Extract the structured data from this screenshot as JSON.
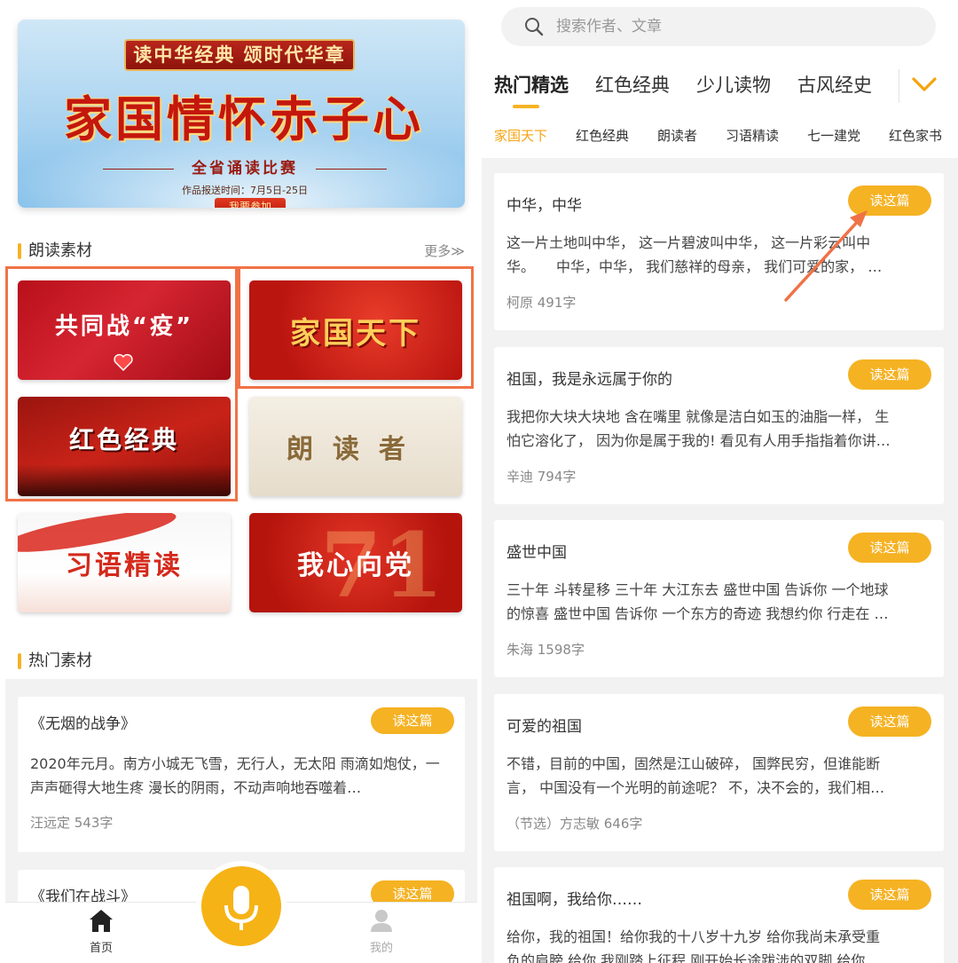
{
  "left": {
    "banner": {
      "plaque": "读中华经典 颂时代华章",
      "title": "家国情怀赤子心",
      "subtitle": "全省诵读比赛",
      "dates": "作品报送时间：7月5日-25日",
      "join": "我要参加"
    },
    "materials": {
      "title": "朗读素材",
      "more": "更多≫",
      "tiles": [
        "共同战“疫”",
        "家国天下",
        "红色经典",
        "朗读者",
        "习语精读",
        "我心向党"
      ]
    },
    "hot": {
      "title": "热门素材",
      "cards": [
        {
          "title": "《无烟的战争》",
          "button": "读这篇",
          "excerpt": "2020年元月。南方小城无飞雪，无行人，无太阳 雨滴如炮仗，一声声砸得大地生疼 漫长的阴雨，不动声响地吞噬着…",
          "meta": "汪远定 543字"
        },
        {
          "title": "《我们在战斗》",
          "button": "读这篇"
        }
      ]
    },
    "nav": {
      "home": "首页",
      "mine": "我的"
    }
  },
  "right": {
    "search": {
      "placeholder": "搜索作者、文章"
    },
    "tabs": [
      "热门精选",
      "红色经典",
      "少儿读物",
      "古风经史"
    ],
    "subtabs": [
      "家国天下",
      "红色经典",
      "朗读者",
      "习语精读",
      "七一建党",
      "红色家书"
    ],
    "cards": [
      {
        "title": "中华，中华",
        "button": "读这篇",
        "line1": "这一片土地叫中华， 这一片碧波叫中华， 这一片彩云叫中",
        "line2": "华。　　中华，中华， 我们慈祥的母亲， 我们可爱的家， …",
        "meta": "柯原 491字"
      },
      {
        "title": "祖国，我是永远属于你的",
        "button": "读这篇",
        "line1": "我把你大块大块地 含在嘴里 就像是洁白如玉的油脂一样， 生",
        "line2": "怕它溶化了， 因为你是属于我的! 看见有人用手指指着你讲…",
        "meta": "辛迪 794字"
      },
      {
        "title": "盛世中国",
        "button": "读这篇",
        "line1": "三十年 斗转星移 三十年 大江东去 盛世中国 告诉你 一个地球",
        "line2": "的惊喜 盛世中国 告诉你 一个东方的奇迹 我想约你 行走在 …",
        "meta": "朱海 1598字"
      },
      {
        "title": "可爱的祖国",
        "button": "读这篇",
        "line1": "不错，目前的中国，固然是江山破碎， 国弊民穷，但谁能断",
        "line2": "言， 中国没有一个光明的前途呢？ 不，决不会的，我们相…",
        "meta": "（节选）方志敏 646字"
      },
      {
        "title": "祖国啊，我给你……",
        "button": "读这篇",
        "line1": "给你，我的祖国！给你我的十八岁十九岁 给你我尚未承受重",
        "line2": "负的肩膀 给你 我刚踏上征程 刚开始长途跋涉的双脚 给你"
      }
    ]
  },
  "colors": {
    "accent": "#f5b223",
    "highlight": "#f07247",
    "active_subtab": "#f5a30f"
  }
}
